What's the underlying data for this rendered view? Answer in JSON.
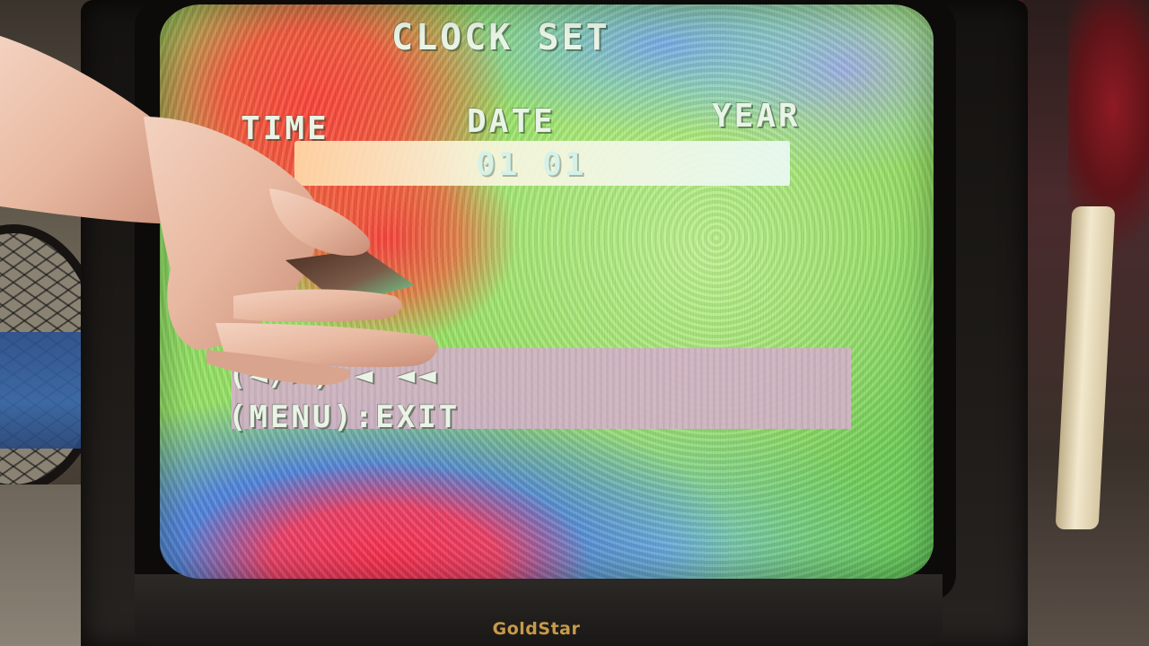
{
  "osd": {
    "title": "CLOCK SET",
    "time_label": "TIME",
    "date_label": "DATE",
    "year_label": "YEAR",
    "date_value": "01 01",
    "hint": "(◄/►) ◄ ◄◄",
    "exit": "(MENU):EXIT"
  },
  "tv": {
    "brand": "GoldStar"
  },
  "colors": {
    "brand_gold": "#c79a4a",
    "osd_text": "#e9f3e6",
    "screen_green": "#8fdc5c",
    "screen_red": "#ff4a3c",
    "screen_blue": "#466ef0"
  }
}
